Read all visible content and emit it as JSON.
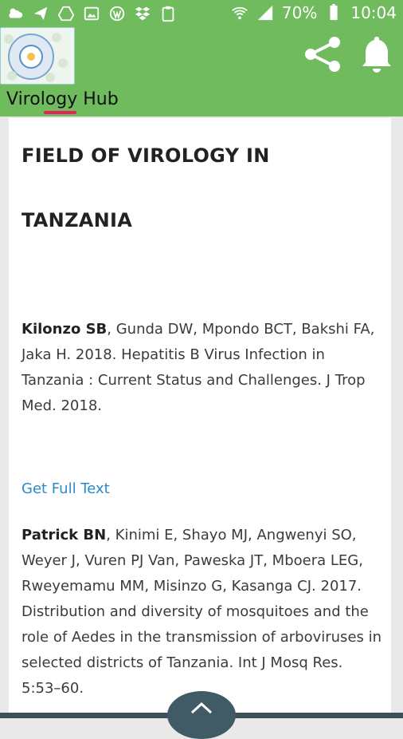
{
  "status_bar": {
    "battery": "70%",
    "time": "10:04"
  },
  "app_bar": {
    "title": "Virology Hub",
    "share_icon": "share-icon",
    "bell_icon": "bell-icon"
  },
  "article": {
    "heading_line1": "FIELD OF VIROLOGY IN",
    "heading_line2": "TANZANIA",
    "citation1_author": "Kilonzo SB",
    "citation1_rest": ", Gunda DW, Mpondo BCT, Bakshi FA, Jaka H. 2018. Hepatitis B Virus Infection in Tanzania : Current Status and Challenges. J Trop Med. 2018.",
    "full_text_link": "Get Full Text",
    "citation2_author": "Patrick BN",
    "citation2_rest": ", Kinimi E, Shayo MJ, Angwenyi SO, Weyer J, Vuren PJ Van, Paweska JT, Mboera LEG, Rweyemamu MM, Misinzo G, Kasanga CJ. 2017. Distribution and diversity of mosquitoes and the role of Aedes in the transmission of arboviruses in selected districts of Tanzania. Int J Mosq Res. 5:53–60."
  },
  "scroll_button_icon": "chevron-up-icon"
}
